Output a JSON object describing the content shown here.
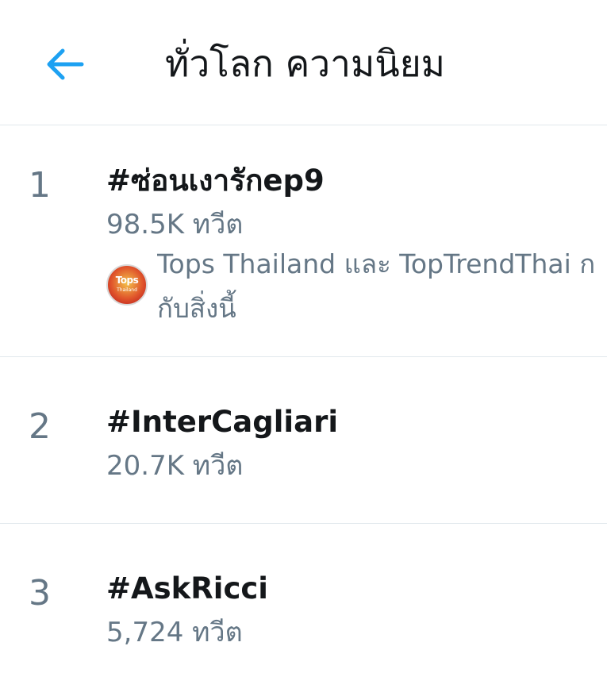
{
  "header": {
    "back_icon": "arrow-left-icon",
    "title": "ทั่วโลก ความนิยม",
    "accent_color": "#1da1f2"
  },
  "trends": [
    {
      "rank": "1",
      "name": "#ซ่อนเงารักep9",
      "tweets": "98.5K ทวีต",
      "context": {
        "avatar_brand": "Tops",
        "avatar_sub": "Thailand",
        "line1": "Tops Thailand และ TopTrendThai ก",
        "line2": "กับสิ่งนี้"
      }
    },
    {
      "rank": "2",
      "name": "#InterCagliari",
      "tweets": "20.7K ทวีต"
    },
    {
      "rank": "3",
      "name": "#AskRicci",
      "tweets": "5,724 ทวีต"
    }
  ]
}
